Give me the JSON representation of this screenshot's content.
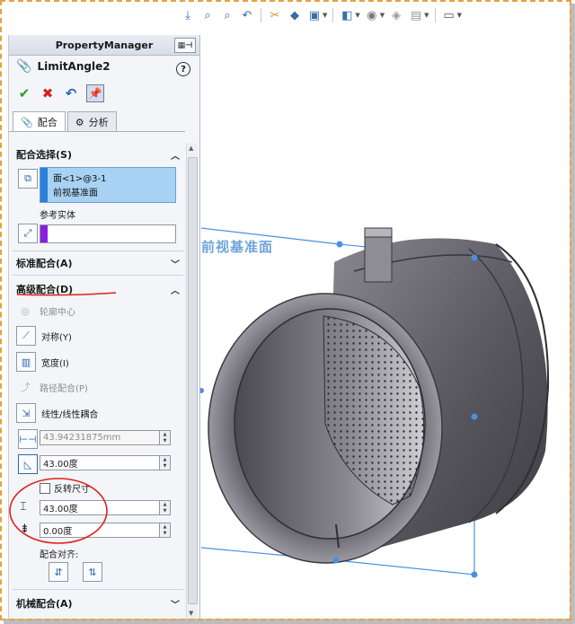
{
  "toolbar": {
    "icons": [
      "view-orientation-icon",
      "zoom-to-fit-icon",
      "zoom-area-icon",
      "previous-view-icon",
      "section-view-icon",
      "view-cube-icon",
      "display-style-icon",
      "hide-show-icon",
      "edit-appearance-icon",
      "apply-scene-icon",
      "view-settings-icon",
      "monitor-icon"
    ]
  },
  "property_manager": {
    "title": "PropertyManager",
    "feature_name": "LimitAngle2",
    "help": "?",
    "tabs": [
      {
        "label": "配合"
      },
      {
        "label": "分析"
      }
    ],
    "sections": {
      "mate_selection": {
        "title": "配合选择(S)",
        "selections": [
          "面<1>@3-1",
          "前视基准面"
        ],
        "reference_label": "参考实体",
        "reference_color": "#8a1ee0"
      },
      "standard": {
        "title": "标准配合(A)"
      },
      "advanced": {
        "title": "高级配合(D)",
        "options": [
          {
            "label": "轮廓中心",
            "icon": "profile-center-icon",
            "enabled": false
          },
          {
            "label": "对称(Y)",
            "icon": "symmetric-icon",
            "enabled": true
          },
          {
            "label": "宽度(I)",
            "icon": "width-icon",
            "enabled": true
          },
          {
            "label": "路径配合(P)",
            "icon": "path-mate-icon",
            "enabled": false
          },
          {
            "label": "线性/线性耦合",
            "icon": "linear-coupler-icon",
            "enabled": true
          }
        ],
        "distance_value": "43.94231875mm",
        "angle_value": "43.00度",
        "flip_label": "反转尺寸",
        "max_value": "43.00度",
        "min_value": "0.00度",
        "align_label": "配合对齐:"
      },
      "mechanical": {
        "title": "机械配合(A)"
      }
    }
  },
  "viewport": {
    "plane_label": "前视基准面",
    "accent": "#4a90e2",
    "annotation_color": "#e0201c"
  }
}
